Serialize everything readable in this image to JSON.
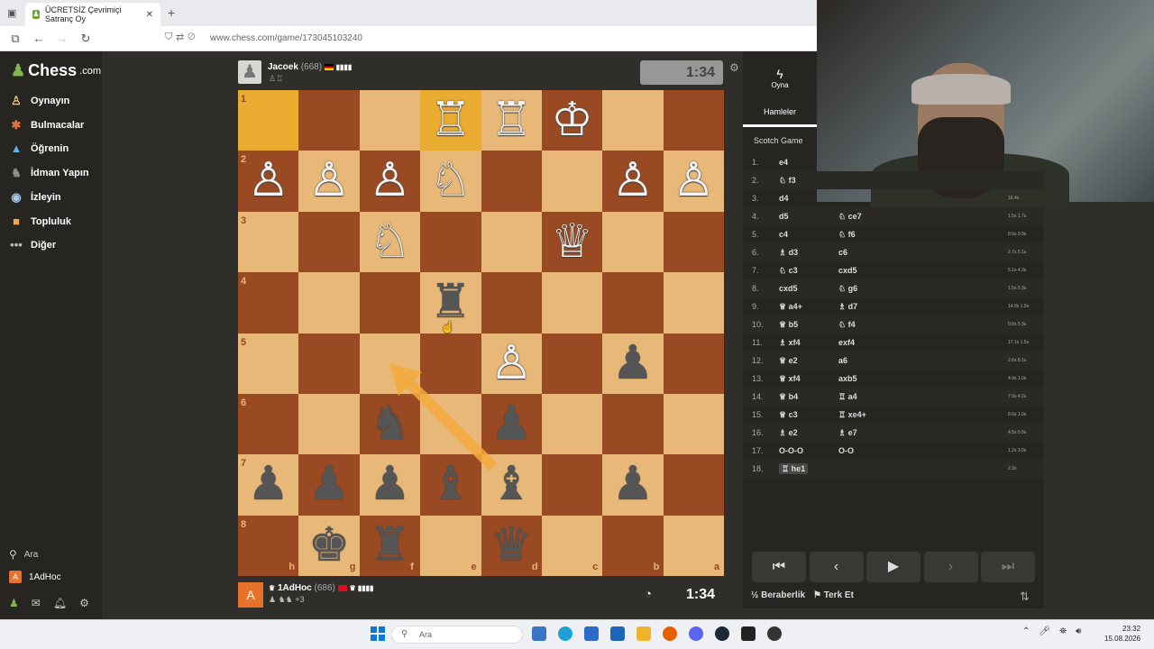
{
  "browser": {
    "tab_title": "ÜCRETSİZ Çevrimiçi Satranç Oy",
    "tab_close": "✕",
    "new_tab": "+",
    "url": "www.chess.com/game/173045103240"
  },
  "sidebar": {
    "logo_text": "Chess",
    "logo_suffix": ".com",
    "items": [
      {
        "label": "Oynayın",
        "icon": "♙",
        "color": "#f1c27d"
      },
      {
        "label": "Bulmacalar",
        "icon": "✱",
        "color": "#e0743b"
      },
      {
        "label": "Öğrenin",
        "icon": "▲",
        "color": "#5bb3e8"
      },
      {
        "label": "İdman Yapın",
        "icon": "♞",
        "color": "#8c8c8c"
      },
      {
        "label": "İzleyin",
        "icon": "◉",
        "color": "#a4c8e8"
      },
      {
        "label": "Topluluk",
        "icon": "■",
        "color": "#f2a34c"
      },
      {
        "label": "Diğer",
        "icon": "•••",
        "color": "#bbbbbb"
      }
    ],
    "search_label": "Ara",
    "user_label": "1AdHoc",
    "user_initial": "A"
  },
  "top_player": {
    "name": "Jacoek",
    "rating": "(668)",
    "clock": "1:34"
  },
  "bottom_player": {
    "name": "1AdHoc",
    "rating": "(686)",
    "extra": "+3",
    "initial": "A",
    "clock": "1:34"
  },
  "board": {
    "rank_labels": [
      "1",
      "2",
      "3",
      "4",
      "5",
      "6",
      "7",
      "8"
    ],
    "file_labels": [
      "h",
      "g",
      "f",
      "e",
      "d",
      "c",
      "b",
      "a"
    ],
    "highlight_squares": [
      [
        0,
        0
      ],
      [
        0,
        3
      ]
    ],
    "pieces": [
      {
        "r": 0,
        "c": 3,
        "p": "♖",
        "side": "w"
      },
      {
        "r": 0,
        "c": 4,
        "p": "♖",
        "side": "w"
      },
      {
        "r": 0,
        "c": 5,
        "p": "♔",
        "side": "w"
      },
      {
        "r": 1,
        "c": 0,
        "p": "♙",
        "side": "w"
      },
      {
        "r": 1,
        "c": 1,
        "p": "♙",
        "side": "w"
      },
      {
        "r": 1,
        "c": 2,
        "p": "♙",
        "side": "w"
      },
      {
        "r": 1,
        "c": 3,
        "p": "♘",
        "side": "w"
      },
      {
        "r": 1,
        "c": 6,
        "p": "♙",
        "side": "w"
      },
      {
        "r": 1,
        "c": 7,
        "p": "♙",
        "side": "w"
      },
      {
        "r": 2,
        "c": 2,
        "p": "♘",
        "side": "w"
      },
      {
        "r": 2,
        "c": 5,
        "p": "♕",
        "side": "w"
      },
      {
        "r": 3,
        "c": 3,
        "p": "♜",
        "side": "b"
      },
      {
        "r": 4,
        "c": 4,
        "p": "♙",
        "side": "w"
      },
      {
        "r": 4,
        "c": 6,
        "p": "♟",
        "side": "b"
      },
      {
        "r": 5,
        "c": 2,
        "p": "♞",
        "side": "b"
      },
      {
        "r": 5,
        "c": 4,
        "p": "♟",
        "side": "b"
      },
      {
        "r": 6,
        "c": 0,
        "p": "♟",
        "side": "b"
      },
      {
        "r": 6,
        "c": 1,
        "p": "♟",
        "side": "b"
      },
      {
        "r": 6,
        "c": 2,
        "p": "♟",
        "side": "b"
      },
      {
        "r": 6,
        "c": 3,
        "p": "♝",
        "side": "b"
      },
      {
        "r": 6,
        "c": 4,
        "p": "♝",
        "side": "b"
      },
      {
        "r": 6,
        "c": 6,
        "p": "♟",
        "side": "b"
      },
      {
        "r": 7,
        "c": 1,
        "p": "♚",
        "side": "b"
      },
      {
        "r": 7,
        "c": 2,
        "p": "♜",
        "side": "b"
      },
      {
        "r": 7,
        "c": 4,
        "p": "♛",
        "side": "b"
      }
    ]
  },
  "panel": {
    "play_label": "Oyna",
    "moves_label": "Hamleler",
    "opening": "Scotch Game",
    "moves": [
      {
        "no": "1.",
        "w": "e4",
        "b": "",
        "t": ""
      },
      {
        "no": "2.",
        "w": "♘ f3",
        "b": "",
        "t": ""
      },
      {
        "no": "3.",
        "w": "d4",
        "b": "",
        "t": "16.4s"
      },
      {
        "no": "4.",
        "w": "d5",
        "b": "♘ ce7",
        "t": "1.5s 1.7s"
      },
      {
        "no": "5.",
        "w": "c4",
        "b": "♘ f6",
        "t": "8.5s 0.9s"
      },
      {
        "no": "6.",
        "w": "♗ d3",
        "b": "c6",
        "t": "2.7s 5.1s"
      },
      {
        "no": "7.",
        "w": "♘ c3",
        "b": "cxd5",
        "t": "5.1s 4.3s"
      },
      {
        "no": "8.",
        "w": "cxd5",
        "b": "♘ g6",
        "t": "1.5s 5.3s"
      },
      {
        "no": "9.",
        "w": "♕ a4+",
        "b": "♗ d7",
        "t": "14.0s 1.9s"
      },
      {
        "no": "10.",
        "w": "♕ b5",
        "b": "♘ f4",
        "t": "0.6s 5.3s"
      },
      {
        "no": "11.",
        "w": "♗ xf4",
        "b": "exf4",
        "t": "17.1s 1.5s"
      },
      {
        "no": "12.",
        "w": "♕ e2",
        "b": "a6",
        "t": "2.6s 8.1s"
      },
      {
        "no": "13.",
        "w": "♕ xf4",
        "b": "axb5",
        "t": "4.9s 1.0s"
      },
      {
        "no": "14.",
        "w": "♕ b4",
        "b": "♖ a4",
        "t": "7.9s 4.2s"
      },
      {
        "no": "15.",
        "w": "♕ c3",
        "b": "♖ xe4+",
        "t": "8.6s 1.0s"
      },
      {
        "no": "16.",
        "w": "♗ e2",
        "b": "♗ e7",
        "t": "4.5s 5.9s"
      },
      {
        "no": "17.",
        "w": "O-O-O",
        "b": "O-O",
        "t": "1.2s 3.0s"
      },
      {
        "no": "18.",
        "w": "♖ he1",
        "b": "",
        "t": "2.3s"
      }
    ],
    "controls": [
      "⏮",
      "‹",
      "▶",
      "›",
      "⏭"
    ],
    "draw_label": "Beraberlik",
    "draw_icon": "½",
    "resign_label": "Terk Et",
    "resign_icon": "⚑",
    "flip_icon": "⇅"
  },
  "taskbar": {
    "search_label": "Ara",
    "time": "23:32",
    "date": "15.08.2026"
  }
}
